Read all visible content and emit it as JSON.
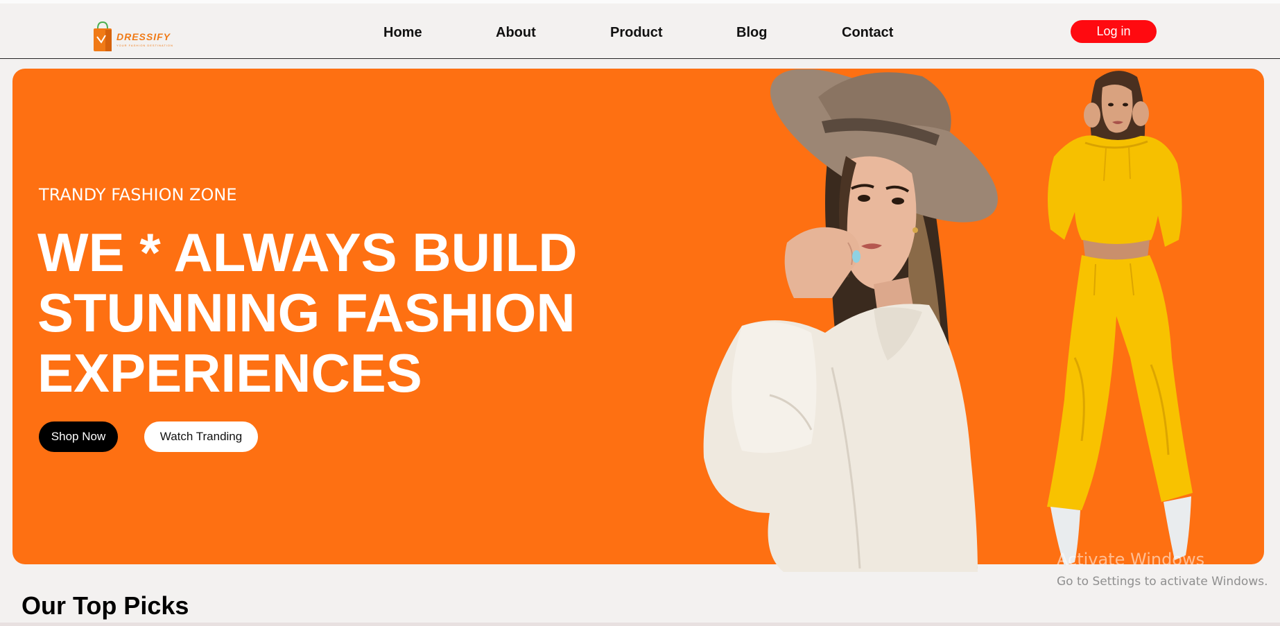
{
  "brand": {
    "name": "DRESSIFY",
    "tagline": "YOUR FASHION DESTINATION",
    "color": "#f07a16"
  },
  "nav": {
    "items": [
      {
        "label": "Home"
      },
      {
        "label": "About"
      },
      {
        "label": "Product"
      },
      {
        "label": "Blog"
      },
      {
        "label": "Contact"
      }
    ],
    "login_label": "Log in",
    "login_color": "#ff0a10"
  },
  "hero": {
    "background": "#fe7012",
    "subtitle": "TRANDY FASHION ZONE",
    "title_line1": "WE * ALWAYS BUILD",
    "title_line2": "STUNNING FASHION",
    "title_line3": "EXPERIENCES",
    "shop_label": "Shop Now",
    "watch_label": "Watch Tranding"
  },
  "watermark": {
    "title": "Activate Windows",
    "subtitle": "Go to Settings to activate Windows."
  },
  "section": {
    "title": "Our Top Picks"
  }
}
